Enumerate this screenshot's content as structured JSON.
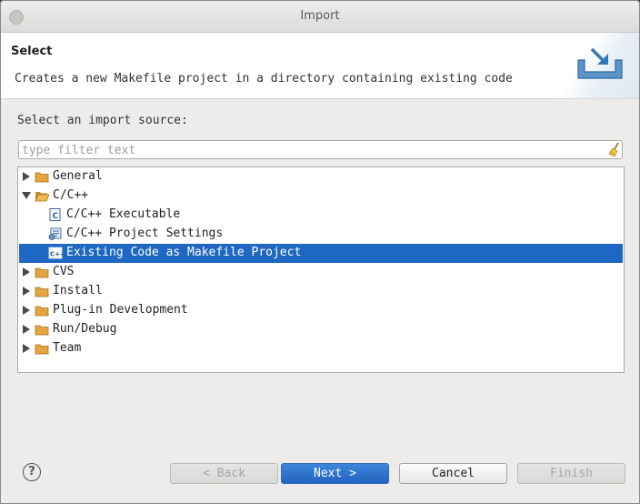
{
  "window": {
    "title": "Import"
  },
  "header": {
    "title": "Select",
    "description": "Creates a new Makefile project in a directory containing existing code"
  },
  "source_label": "Select an import source:",
  "filter": {
    "placeholder": "type filter text",
    "value": ""
  },
  "tree": {
    "items": [
      {
        "label": "General",
        "expanded": false,
        "selected": false
      },
      {
        "label": "C/C++",
        "expanded": true,
        "selected": false
      },
      {
        "label": "C/C++ Executable",
        "icon": "c-executable-icon",
        "selected": false
      },
      {
        "label": "C/C++ Project Settings",
        "icon": "project-settings-icon",
        "selected": false
      },
      {
        "label": "Existing Code as Makefile Project",
        "icon": "makefile-project-icon",
        "selected": true
      },
      {
        "label": "CVS",
        "expanded": false,
        "selected": false
      },
      {
        "label": "Install",
        "expanded": false,
        "selected": false
      },
      {
        "label": "Plug-in Development",
        "expanded": false,
        "selected": false
      },
      {
        "label": "Run/Debug",
        "expanded": false,
        "selected": false
      },
      {
        "label": "Team",
        "expanded": false,
        "selected": false
      }
    ]
  },
  "buttons": {
    "help": "?",
    "back": "< Back",
    "next": "Next >",
    "cancel": "Cancel",
    "finish": "Finish"
  },
  "colors": {
    "selection": "#1e68c4",
    "folder": "#e3a540",
    "primary_button": "#2e72cf"
  }
}
